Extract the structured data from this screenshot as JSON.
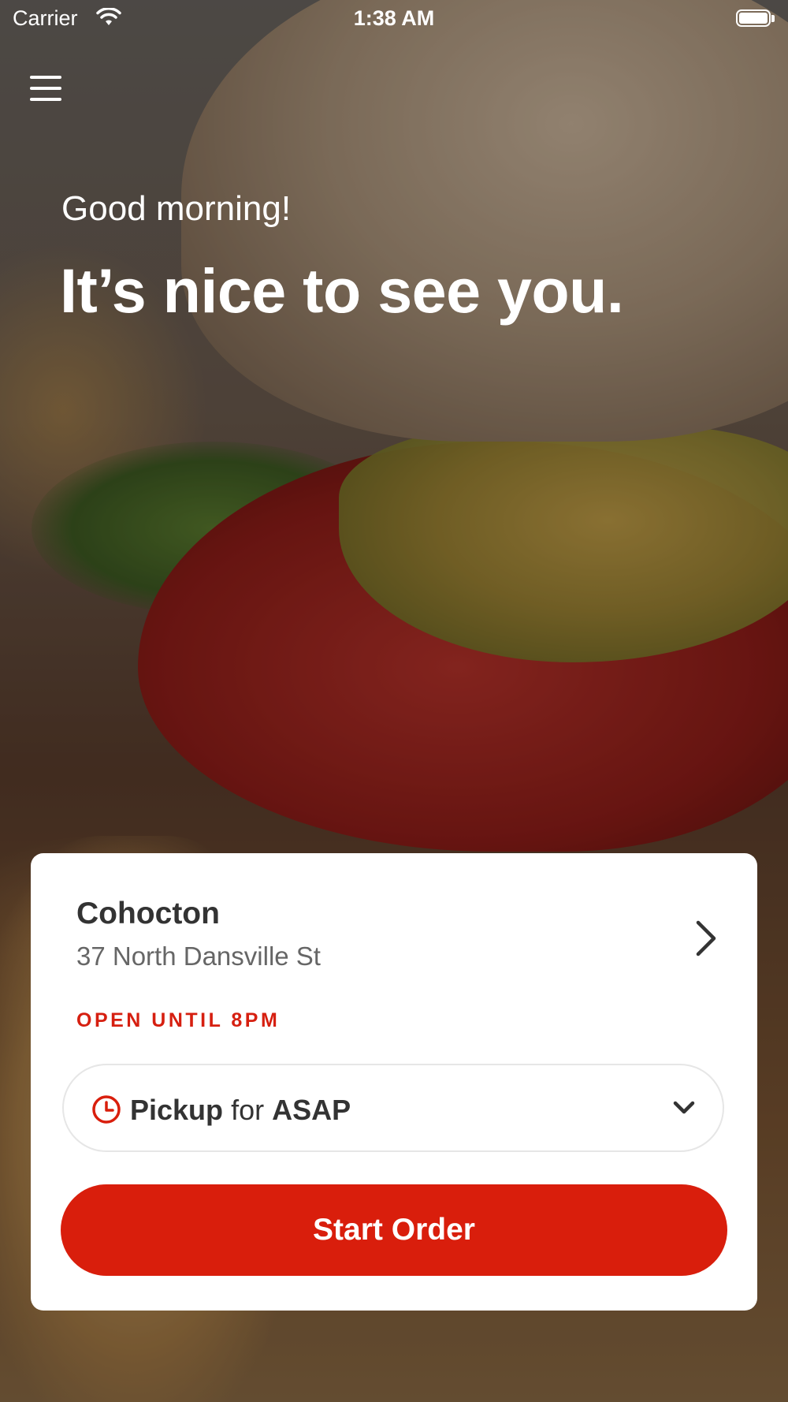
{
  "status_bar": {
    "carrier": "Carrier",
    "time": "1:38 AM"
  },
  "header": {
    "menu_icon": "hamburger-menu-icon"
  },
  "hero": {
    "greeting": "Good morning!",
    "headline": "It’s nice to see you."
  },
  "location_card": {
    "store_name": "Cohocton",
    "address": "37 North Dansville St",
    "hours": "OPEN UNTIL 8PM",
    "order_mode": {
      "type": "Pickup",
      "connector": "for",
      "time": "ASAP"
    },
    "start_button_label": "Start Order"
  },
  "colors": {
    "accent_red": "#d91e0c",
    "hours_red": "#d61f10",
    "card_bg": "#ffffff",
    "text_dark": "#333333",
    "text_muted": "#666666"
  }
}
